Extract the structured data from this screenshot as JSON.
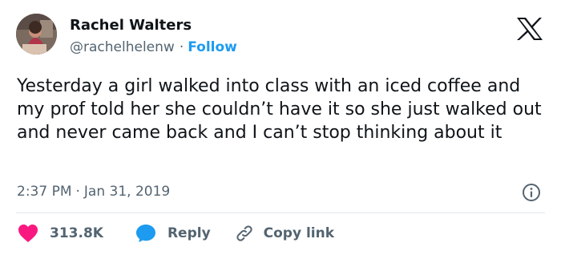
{
  "user": {
    "name": "Rachel Walters",
    "handle": "@rachelhelenw",
    "separator": "·",
    "follow_label": "Follow"
  },
  "tweet": {
    "text": "Yesterday a girl walked into class with an iced coffee and my prof told her she couldn’t have it so she just walked out and never came back and I can’t stop thinking about it",
    "time": "2:37 PM",
    "separator": "·",
    "date": "Jan 31, 2019"
  },
  "actions": {
    "like_count": "313.8K",
    "reply_label": "Reply",
    "copy_label": "Copy link"
  },
  "icons": {
    "logo": "x-logo-icon",
    "info": "info-icon",
    "like": "heart-icon",
    "reply": "speech-bubble-icon",
    "copy": "link-icon"
  },
  "colors": {
    "accent": "#1d9bf0",
    "like": "#f91880",
    "text": "#0f1419",
    "secondary": "#536471"
  }
}
